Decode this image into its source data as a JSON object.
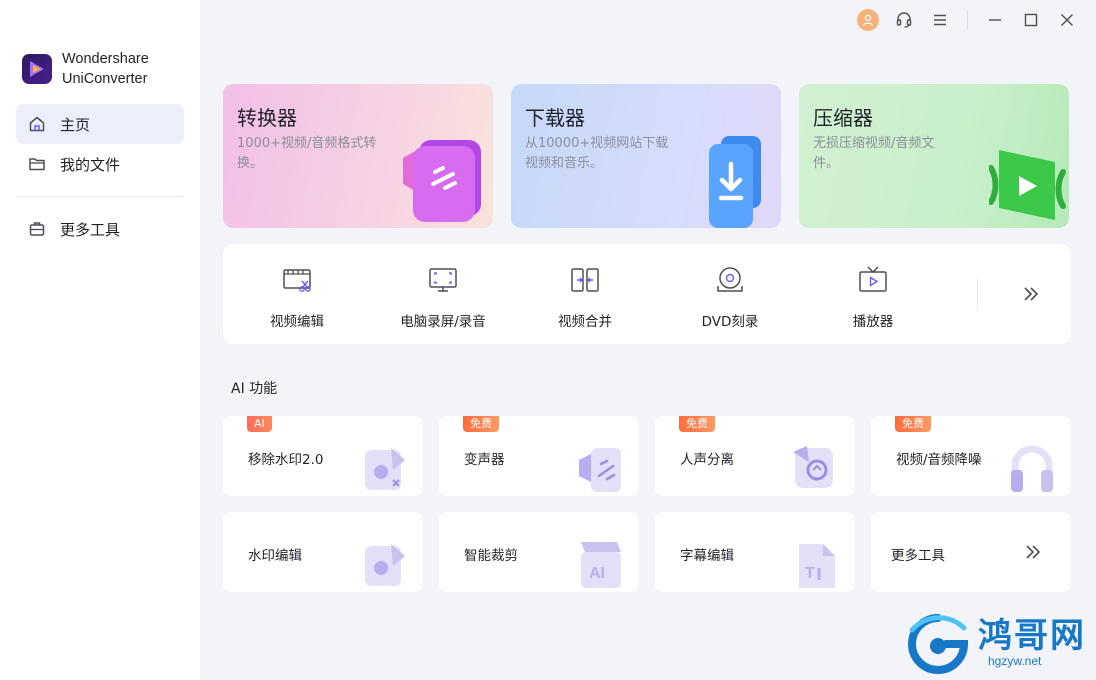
{
  "brand": {
    "line1": "Wondershare",
    "line2": "UniConverter"
  },
  "sidebar": {
    "items": [
      {
        "label": "主页",
        "icon": "home-icon",
        "active": true
      },
      {
        "label": "我的文件",
        "icon": "folder-icon",
        "active": false
      },
      {
        "label": "更多工具",
        "icon": "toolbox-icon",
        "active": false
      }
    ]
  },
  "hero": [
    {
      "title": "转换器",
      "desc": "1000+视频/音频格式转换。"
    },
    {
      "title": "下载器",
      "desc": "从10000+视频网站下载视频和音乐。"
    },
    {
      "title": "压缩器",
      "desc": "无损压缩视频/音频文件。"
    }
  ],
  "tools": [
    {
      "label": "视频编辑",
      "icon": "video-edit-icon"
    },
    {
      "label": "电脑录屏/录音",
      "icon": "screen-record-icon"
    },
    {
      "label": "视频合并",
      "icon": "video-merge-icon"
    },
    {
      "label": "DVD刻录",
      "icon": "dvd-burn-icon"
    },
    {
      "label": "播放器",
      "icon": "player-icon"
    }
  ],
  "ai_section": {
    "heading": "AI 功能"
  },
  "ai_cards": [
    {
      "label": "移除水印2.0",
      "badge": "AI"
    },
    {
      "label": "变声器",
      "badge": "免费"
    },
    {
      "label": "人声分离",
      "badge": "免费"
    },
    {
      "label": "视频/音频降噪",
      "badge": "免费"
    },
    {
      "label": "水印编辑",
      "badge": ""
    },
    {
      "label": "智能裁剪",
      "badge": ""
    },
    {
      "label": "字幕编辑",
      "badge": ""
    },
    {
      "label": "更多工具",
      "badge": ""
    }
  ],
  "watermark": {
    "big": "鸿哥网",
    "small": "hgzyw.net"
  },
  "colors": {
    "accent": "#6b5cf6",
    "active_nav": "#eceefc",
    "badge": "#ff6b4a"
  }
}
